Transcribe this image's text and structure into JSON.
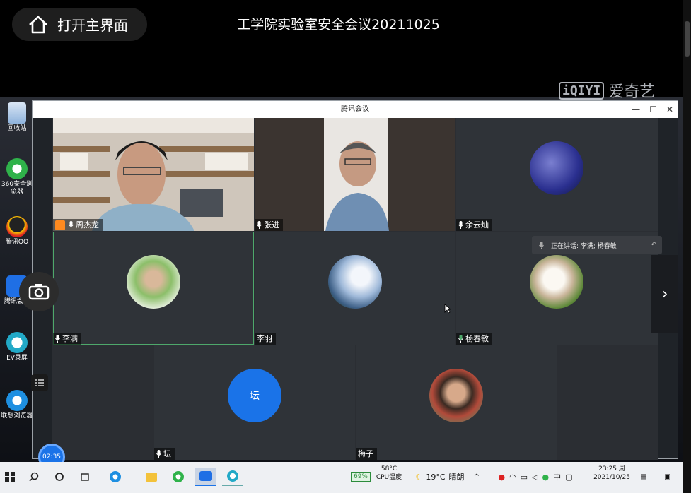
{
  "player": {
    "home_label": "打开主界面",
    "video_title": "工学院实验室安全会议20211025",
    "watermark_brand": "爱奇艺",
    "watermark_logo": "iQIYI"
  },
  "desktop_icons": [
    {
      "label": "回收站",
      "icon": "recycle-bin-icon"
    },
    {
      "label": "360安全浏览器",
      "icon": "360-browser-icon"
    },
    {
      "label": "腾讯QQ",
      "icon": "qq-icon"
    },
    {
      "label": "腾讯会议",
      "icon": "tencent-meeting-icon"
    },
    {
      "label": "EV录屏",
      "icon": "ev-recorder-icon"
    },
    {
      "label": "联想浏览器",
      "icon": "lenovo-browser-icon"
    }
  ],
  "meeting_window": {
    "title": "腾讯会议",
    "controls": [
      "—",
      "☐",
      "✕"
    ],
    "speaking_indicator": "正在讲话: 李满; 杨春敏",
    "participants": [
      {
        "name": "周杰龙",
        "type": "video"
      },
      {
        "name": "张进",
        "type": "video"
      },
      {
        "name": "余云灿",
        "type": "avatar"
      },
      {
        "name": "李满",
        "type": "avatar"
      },
      {
        "name": "李羽",
        "type": "avatar"
      },
      {
        "name": "杨春敏",
        "type": "avatar"
      },
      {
        "name": "坛",
        "type": "initial",
        "initial": "坛"
      },
      {
        "name": "梅子",
        "type": "avatar"
      }
    ],
    "next_arrow": "›"
  },
  "overlay": {
    "timer": "02:35"
  },
  "taskbar": {
    "battery": "69%",
    "cpu_temp": "58°C",
    "cpu_label": "CPU温度",
    "weather_temp": "19°C",
    "weather_desc": "晴朗",
    "ime": "中",
    "time": "23:25 周",
    "date": "2021/10/25"
  },
  "colors": {
    "accent_blue": "#1a73e8",
    "speaking_green": "#4ea86b"
  }
}
